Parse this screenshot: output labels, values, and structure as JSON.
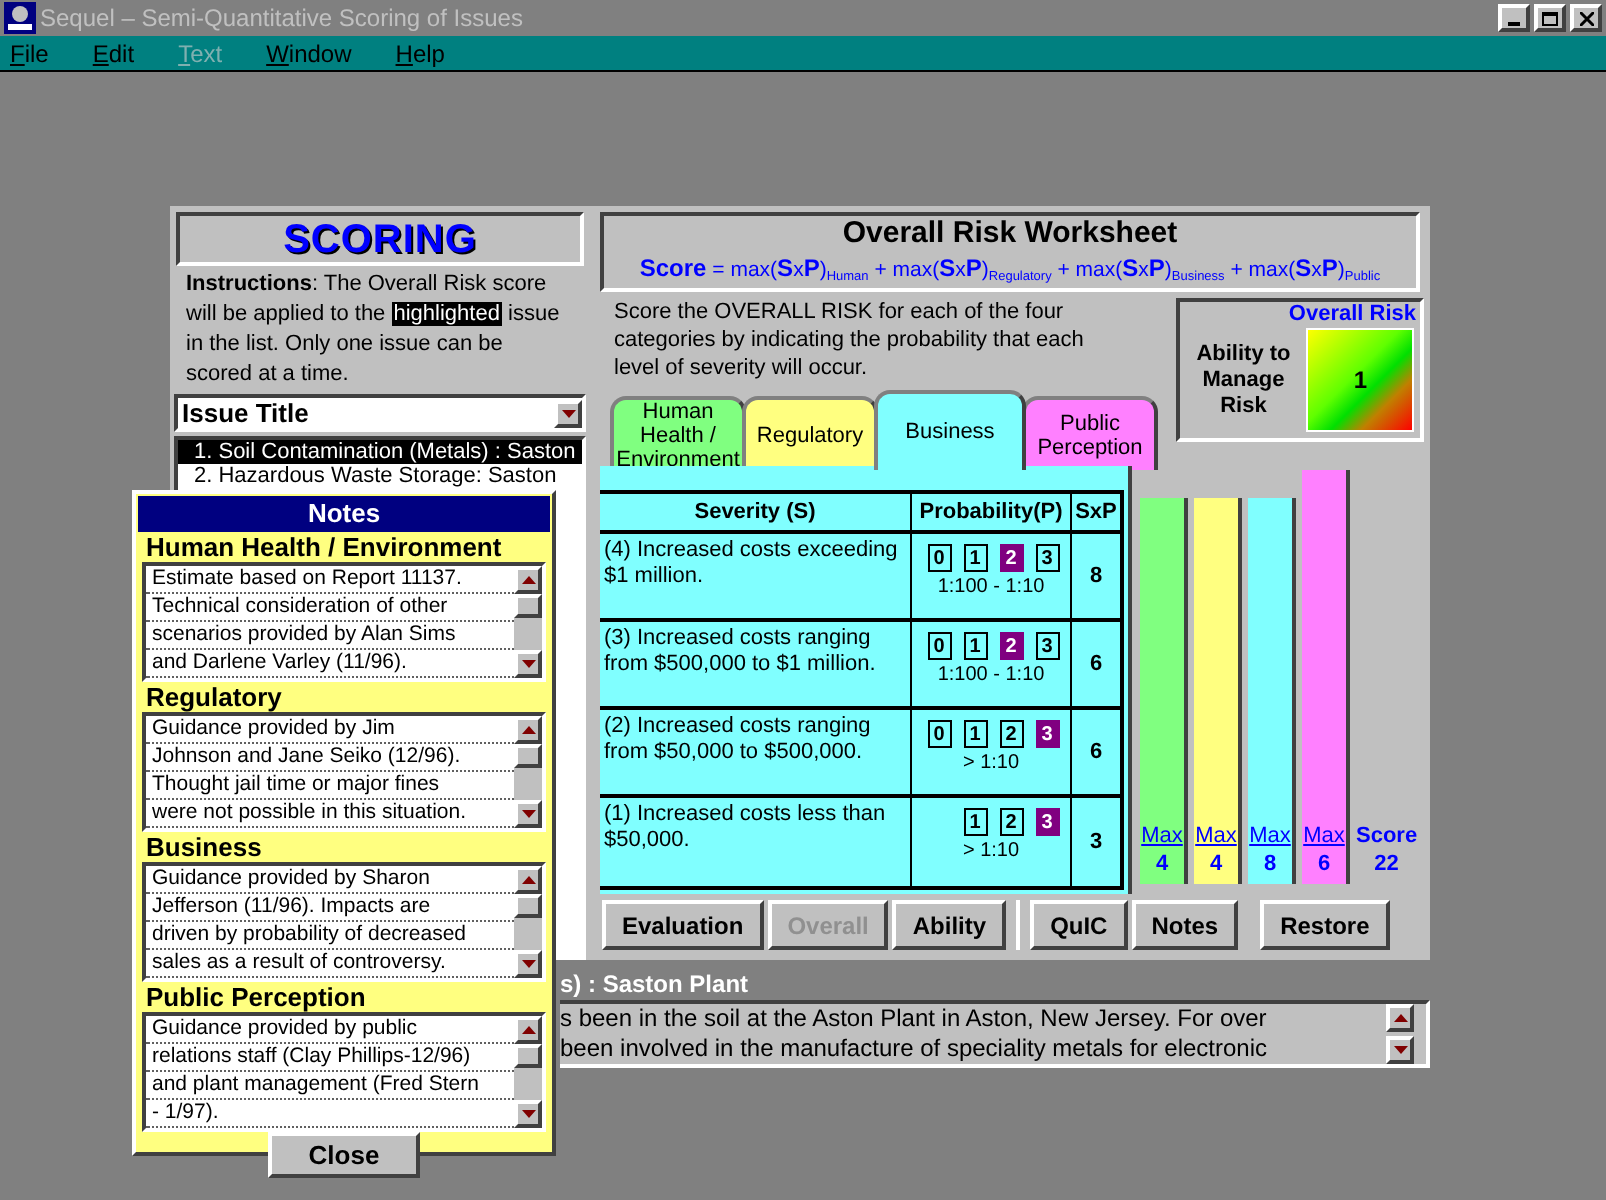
{
  "window": {
    "title": "Sequel – Semi-Quantitative Scoring of Issues"
  },
  "menu": [
    {
      "label": "File",
      "disabled": false
    },
    {
      "label": "Edit",
      "disabled": false
    },
    {
      "label": "Text",
      "disabled": true
    },
    {
      "label": "Window",
      "disabled": false
    },
    {
      "label": "Help",
      "disabled": false
    }
  ],
  "scoring": {
    "heading": "SCORING",
    "instructions": {
      "lead": "Instructions",
      "before": ":  The Overall Risk score will be applied to the ",
      "highlight": "highlighted",
      "after": " issue in the list.  Only one issue can be scored at a time."
    },
    "issue_title": "Issue Title",
    "issues": [
      {
        "title": "1. Soil Contamination (Metals) : Saston",
        "selected": true
      },
      {
        "title": "2. Hazardous Waste Storage: Saston",
        "selected": false
      }
    ]
  },
  "worksheet": {
    "title": "Overall Risk Worksheet",
    "formula": "**Score** = max(**S**x**P**)$_{Human}$ + max(**S**x**P**)$_{Regulatory}$ + max(**S**x**P**)$_{Business}$ + max(**S**x**P**)$_{Public}$",
    "description": "Score the OVERALL RISK for each of the four categories by indicating the probability that each level of severity will occur.",
    "overall_risk": {
      "title": "Overall Risk",
      "label": "Ability to Manage Risk",
      "value": "1"
    },
    "tabs": [
      {
        "label": "Human Health / Environment",
        "color": "#80ff80",
        "selected": false
      },
      {
        "label": "Regulatory",
        "color": "#ffff80",
        "selected": false
      },
      {
        "label": "Business",
        "color": "#80ffff",
        "selected": true
      },
      {
        "label": "Public Perception",
        "color": "#ff80ff",
        "selected": false
      }
    ],
    "columns": [
      "Severity (S)",
      "Probability(P)",
      "SxP"
    ],
    "rows": [
      {
        "severity": "(4)  Increased costs exceeding $1 million.",
        "options": [
          {
            "label": "0",
            "selected": false
          },
          {
            "label": "1",
            "selected": false
          },
          {
            "label": "2",
            "selected": true
          },
          {
            "label": "3",
            "selected": false
          }
        ],
        "range": "1:100 - 1:10",
        "sxp": "8"
      },
      {
        "severity": "(3)  Increased costs ranging from $500,000 to $1 million.",
        "options": [
          {
            "label": "0",
            "selected": false
          },
          {
            "label": "1",
            "selected": false
          },
          {
            "label": "2",
            "selected": true
          },
          {
            "label": "3",
            "selected": false
          }
        ],
        "range": "1:100 - 1:10",
        "sxp": "6"
      },
      {
        "severity": "(2)  Increased costs ranging from $50,000 to $500,000.",
        "options": [
          {
            "label": "0",
            "selected": false
          },
          {
            "label": "1",
            "selected": false
          },
          {
            "label": "2",
            "selected": false
          },
          {
            "label": "3",
            "selected": true
          }
        ],
        "range": "> 1:10",
        "sxp": "6"
      },
      {
        "severity": "(1)  Increased costs less than $50,000.",
        "options": [
          {
            "label": "1",
            "selected": false
          },
          {
            "label": "2",
            "selected": false
          },
          {
            "label": "3",
            "selected": true
          }
        ],
        "range": "> 1:10",
        "sxp": "3"
      }
    ],
    "category_maxima": [
      {
        "label": "Max",
        "value": "4",
        "color": "#80ff80"
      },
      {
        "label": "Max",
        "value": "4",
        "color": "#ffff80"
      },
      {
        "label": "Max",
        "value": "8",
        "color": "#80ffff"
      },
      {
        "label": "Max",
        "value": "6",
        "color": "#ff80ff"
      }
    ],
    "score": {
      "label": "Score",
      "value": "22"
    },
    "buttons": [
      {
        "label": "Evaluation",
        "disabled": false
      },
      {
        "label": "Overall",
        "disabled": true
      },
      {
        "label": "Ability",
        "disabled": false
      }
    ],
    "right_buttons": [
      {
        "label": "QuIC",
        "disabled": false
      },
      {
        "label": "Notes",
        "disabled": false
      },
      {
        "label": "Restore",
        "disabled": false
      }
    ]
  },
  "issue_detail": {
    "title": "s) : Saston Plant",
    "lines": [
      "s been in the soil at the Aston Plant in Aston, New Jersey.  For over",
      "been involved in the manufacture of speciality metals for electronic"
    ]
  },
  "notes": {
    "title": "Notes",
    "sections": [
      {
        "heading": "Human Health / Environment",
        "lines": [
          "Estimate based on Report 11137.",
          "Technical consideration of other",
          "scenarios provided by Alan Sims",
          "and Darlene Varley (11/96)."
        ]
      },
      {
        "heading": "Regulatory",
        "lines": [
          "Guidance provided by Jim",
          "Johnson and Jane Seiko (12/96).",
          "Thought jail time or major fines",
          "were not possible in this situation."
        ]
      },
      {
        "heading": "Business",
        "lines": [
          "Guidance provided by Sharon",
          "Jefferson (11/96).  Impacts are",
          "driven by probability of decreased",
          "sales as a result of controversy."
        ]
      },
      {
        "heading": "Public Perception",
        "lines": [
          "Guidance provided by public",
          "relations staff (Clay Phillips-12/96)",
          "and plant management (Fred Stern",
          "- 1/97)."
        ]
      }
    ],
    "close": "Close"
  }
}
